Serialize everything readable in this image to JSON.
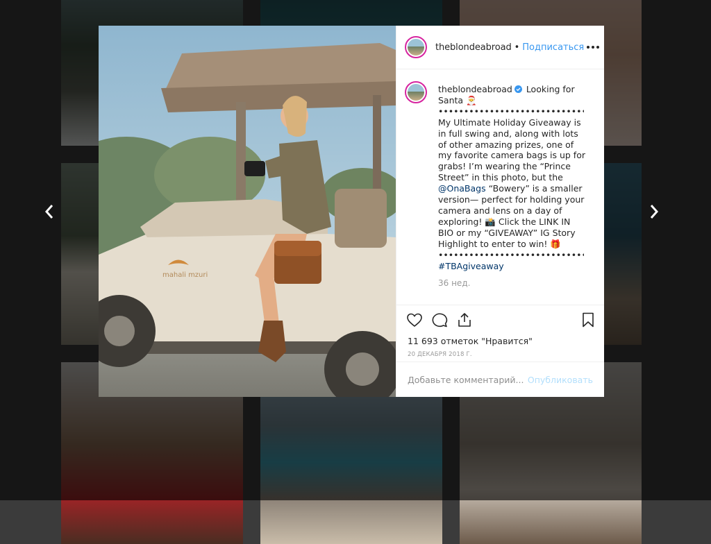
{
  "post": {
    "username": "theblondeabroad",
    "separator": "•",
    "follow_label": "Подписаться",
    "caption_head": "Looking for Santa 🎅",
    "caption_dots_1": "•••••••••••••••••••••••••••••••••••••••••",
    "caption_body_1": "My Ultimate Holiday Giveaway is in full swing and, along with lots of other amazing prizes, one of my favorite camera bags is up for grabs! I’m wearing the “Prince Street” in this photo, but the",
    "mention": "@OnaBags",
    "caption_body_2": "“Bowery” is a smaller version— perfect for holding your camera and lens on a day of exploring! 📸 Click the LINK IN BIO or my “GIVEAWAY” IG Story Highlight to enter to win! 🎁",
    "caption_dots_2": "•••••••••••••••••••••••••••••••••••••••••",
    "hashtag": "#TBAgiveaway",
    "time_ago": "36 нед.",
    "likes_text": "11 693 отметок \"Нравится\"",
    "date": "20 ДЕКАБРЯ 2018 Г.",
    "photo_text": "mahali mzuri"
  },
  "comment_box": {
    "placeholder": "Добавьте комментарий...",
    "publish_label": "Опубликовать"
  },
  "colors": {
    "link_blue": "#3897f0",
    "publish_disabled": "#b2dffc",
    "overlay": "rgba(0,0,0,0.62)"
  },
  "icons": [
    "chevron-left-icon",
    "chevron-right-icon",
    "more-icon",
    "verified-icon",
    "heart-icon",
    "comment-icon",
    "share-icon",
    "bookmark-icon",
    "load-more-icon"
  ]
}
